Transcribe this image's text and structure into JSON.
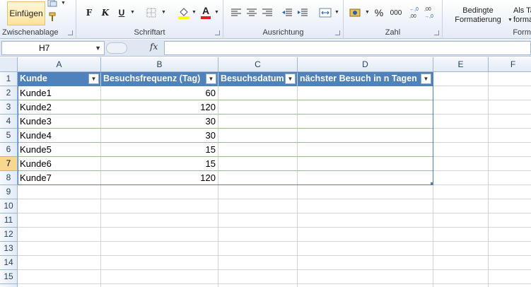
{
  "ribbon": {
    "clipboard": {
      "paste_label": "Einfügen",
      "group_label": "Zwischenablage"
    },
    "font": {
      "bold": "F",
      "italic": "K",
      "underline": "U",
      "font_color_letter": "A",
      "group_label": "Schriftart"
    },
    "alignment": {
      "group_label": "Ausrichtung"
    },
    "number": {
      "percent": "%",
      "thousands": "000",
      "dec_inc": ",0 ,00",
      "dec_dec": ",00 ,0",
      "group_label": "Zahl"
    },
    "styles": {
      "conditional_line1": "Bedingte",
      "conditional_line2": "Formatierung",
      "table_line1": "Als Ta",
      "table_line2": "formati",
      "group_label": "Form"
    }
  },
  "formula_bar": {
    "name_box": "H7",
    "fx": "fx",
    "content": ""
  },
  "columns": [
    "A",
    "B",
    "C",
    "D",
    "E",
    "F"
  ],
  "rows": [
    "1",
    "2",
    "3",
    "4",
    "5",
    "6",
    "7",
    "8",
    "9",
    "10",
    "11",
    "12",
    "13",
    "14",
    "15",
    "16"
  ],
  "active_row": "7",
  "table": {
    "headers": [
      "Kunde",
      "Besuchsfrequenz (Tag)",
      "Besuchsdatum",
      "nächster Besuch in n Tagen"
    ],
    "rows": [
      [
        "Kunde1",
        "60",
        "",
        ""
      ],
      [
        "Kunde2",
        "120",
        "",
        ""
      ],
      [
        "Kunde3",
        "30",
        "",
        ""
      ],
      [
        "Kunde4",
        "30",
        "",
        ""
      ],
      [
        "Kunde5",
        "15",
        "",
        ""
      ],
      [
        "Kunde6",
        "15",
        "",
        ""
      ],
      [
        "Kunde7",
        "120",
        "",
        ""
      ]
    ]
  },
  "colors": {
    "table_header": "#4f81bd",
    "active_row_header": "#f8d88e",
    "font_red": "#e02020",
    "fill_yellow": "#ffff00"
  }
}
